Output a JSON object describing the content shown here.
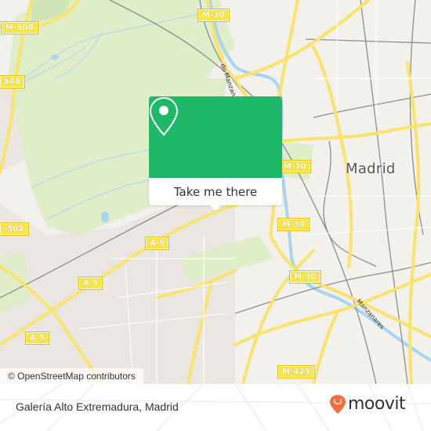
{
  "map": {
    "city_label": "Madrid",
    "road_labels": [
      {
        "id": "m508-top",
        "text": "M-508"
      },
      {
        "id": "m508-left",
        "text": "508"
      },
      {
        "id": "m30-top",
        "text": "M-30"
      },
      {
        "id": "m30-mid",
        "text": "M-30"
      },
      {
        "id": "m30-right",
        "text": "M-30"
      },
      {
        "id": "m30-bottom",
        "text": "M-30"
      },
      {
        "id": "m502",
        "text": "-502"
      },
      {
        "id": "a5-upper",
        "text": "A-5"
      },
      {
        "id": "a5-lower",
        "text": "A-5"
      },
      {
        "id": "a5-left",
        "text": "A-5"
      },
      {
        "id": "m425",
        "text": "M-425"
      }
    ],
    "street_labels": [
      {
        "id": "manzanares-north",
        "text": "do Manzanares"
      },
      {
        "id": "manzanares-south",
        "text": "Manzanares"
      }
    ],
    "colors": {
      "park": "#dfedc9",
      "urban": "#ebe6e1",
      "water": "#a8d4f2",
      "road": "#f9e36b",
      "rail": "#8d8d8d"
    }
  },
  "popup": {
    "icon": "location-pin-icon",
    "button_label": "Take me there",
    "accent_color": "#1fb868"
  },
  "attribution": "© OpenStreetMap contributors",
  "footer": {
    "place_name": "Galería Alto Extremadura, Madrid",
    "brand": {
      "name": "moovit",
      "icon": "moovit-logo-icon",
      "color": "#f26f3a"
    }
  }
}
